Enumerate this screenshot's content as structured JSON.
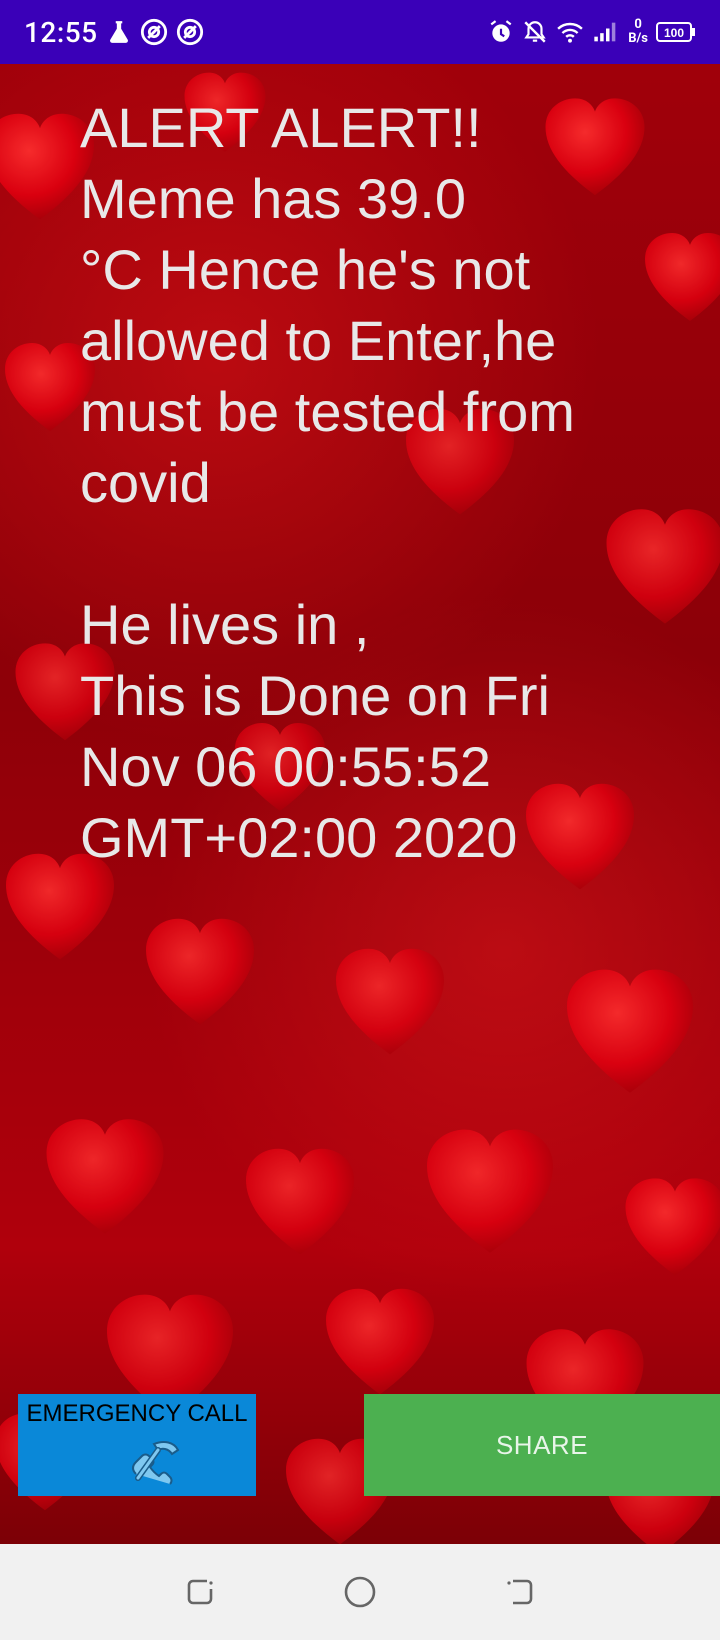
{
  "status_bar": {
    "time": "12:55",
    "net_speed_value": "0",
    "net_speed_unit": "B/s",
    "battery": "100",
    "background_color": "#3a00b8"
  },
  "message": {
    "text": "ALERT ALERT!!\nMeme has 39.0\n°C Hence he's not\nallowed to Enter,he\nmust be tested from\ncovid\n\nHe lives in  ,\nThis is Done on Fri\nNov 06 00:55:52\nGMT+02:00 2020",
    "text_color": "#e8e8e8"
  },
  "buttons": {
    "emergency_label": "EMERGENCY CALL",
    "emergency_color": "#0a88d8",
    "share_label": "SHARE",
    "share_color": "#4cb050"
  },
  "icons": {
    "flask": "flask-icon",
    "at1": "at-sign-icon",
    "at2": "at-sign-icon",
    "alarm": "alarm-icon",
    "mute": "bell-off-icon",
    "wifi": "wifi-icon",
    "signal": "signal-icon",
    "battery": "battery-icon",
    "phone": "phone-icon",
    "recent": "recent-apps-icon",
    "home": "home-icon",
    "back": "back-icon"
  }
}
